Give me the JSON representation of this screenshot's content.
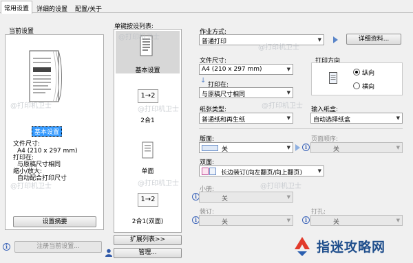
{
  "tabs": [
    {
      "label": "常用设置"
    },
    {
      "label": "详细的设置"
    },
    {
      "label": "配置/关于"
    }
  ],
  "current_settings": {
    "title": "当前设置",
    "selected_caption": "基本设置",
    "details": [
      "文件尺寸:",
      "A4 (210 x 297 mm)",
      "打印在:",
      "与原稿尺寸相同",
      "缩小/放大:",
      "自动配合打印尺寸"
    ],
    "summary_button": "设置摘要",
    "register_button": "注册当前设置..."
  },
  "presets": {
    "title": "单键按设列表:",
    "items": [
      {
        "label": "基本设置",
        "icon": "document-icon"
      },
      {
        "label": "2合1",
        "icon": "two-in-one-icon",
        "glyph": "1→2"
      },
      {
        "label": "单面",
        "icon": "single-sided-icon"
      },
      {
        "label": "2合1(双面)",
        "icon": "two-in-one-duplex-icon",
        "glyph": "1→2"
      }
    ],
    "expand_button": "扩展列表>>",
    "manage_button": "管理..."
  },
  "settings": {
    "job_mode_label": "作业方式:",
    "job_mode_value": "普通打印",
    "details_button": "详细资料...",
    "paper_size_label": "文件尺寸:",
    "paper_size_value": "A4 (210 x 297 mm)",
    "print_on_label": "打印在:",
    "print_on_value": "与原稿尺寸相同",
    "orientation_label": "打印方向",
    "orientation_options": [
      {
        "label": "纵向",
        "selected": true
      },
      {
        "label": "横向",
        "selected": false
      }
    ],
    "paper_type_label": "纸张类型:",
    "paper_type_value": "普通纸和再生纸",
    "input_tray_label": "输入纸盒:",
    "input_tray_value": "自动选择纸盒",
    "layout_label": "版面:",
    "layout_value": "关",
    "page_order_label": "页面顺序:",
    "page_order_value": "关",
    "duplex_label": "双面:",
    "duplex_value": "长边装订(向左翻页/向上翻页)",
    "booklet_label": "小册:",
    "booklet_value": "关",
    "stapling_label": "装订:",
    "stapling_value": "关",
    "punch_label": "打孔:",
    "punch_value": "关"
  },
  "watermark": {
    "repeated_text": "@打印机卫士",
    "brand_text": "指迷攻略网"
  },
  "colors": {
    "accent_blue": "#3a63b8",
    "selection_highlight": "#3399ff",
    "brand_blue": "#1f4e8c"
  }
}
